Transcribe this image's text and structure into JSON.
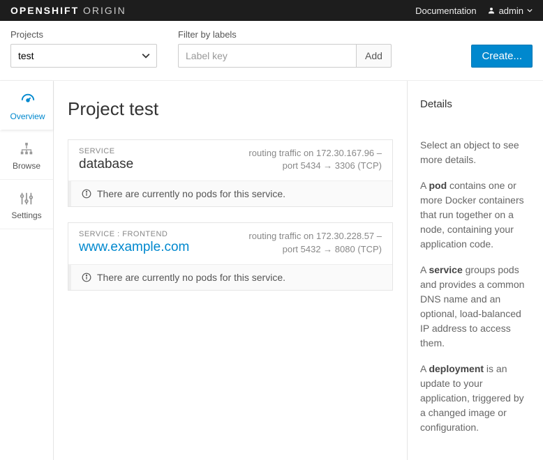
{
  "navbar": {
    "brand_bold": "OPENSHIFT",
    "brand_light": "ORIGIN",
    "doc_link": "Documentation",
    "user": "admin"
  },
  "filterbar": {
    "projects_label": "Projects",
    "project_selected": "test",
    "filter_label": "Filter by labels",
    "filter_placeholder": "Label key",
    "add_btn": "Add",
    "create_btn": "Create..."
  },
  "leftnav": {
    "items": [
      {
        "label": "Overview"
      },
      {
        "label": "Browse"
      },
      {
        "label": "Settings"
      }
    ]
  },
  "main": {
    "title": "Project test",
    "services": [
      {
        "tag": "SERVICE",
        "name": "database",
        "is_link": false,
        "route_line1": "routing traffic on 172.30.167.96 –",
        "route_line2": "port 5434 → 3306 (TCP)",
        "pods_msg": "There are currently no pods for this service."
      },
      {
        "tag": "SERVICE : FRONTEND",
        "name": "www.example.com",
        "is_link": true,
        "route_line1": "routing traffic on 172.30.228.57 –",
        "route_line2": "port 5432 → 8080 (TCP)",
        "pods_msg": "There are currently no pods for this service."
      }
    ]
  },
  "details": {
    "heading": "Details",
    "intro": "Select an object to see more details.",
    "pod_term": "pod",
    "pod_text": " contains one or more Docker containers that run together on a node, containing your application code.",
    "service_term": "service",
    "service_text": " groups pods and provides a common DNS name and an optional, load-balanced IP address to access them.",
    "deployment_term": "deployment",
    "deployment_text": " is an update to your application, triggered by a changed image or configuration."
  }
}
